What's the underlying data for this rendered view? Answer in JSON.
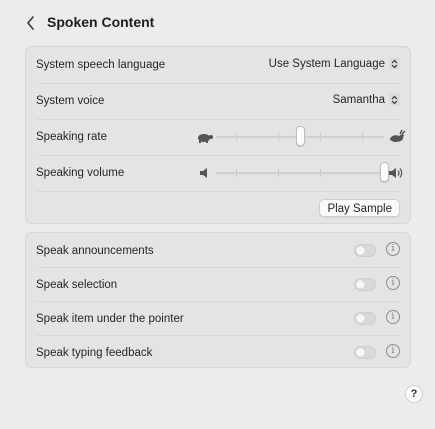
{
  "page": {
    "title": "Spoken Content"
  },
  "speech": {
    "language_label": "System speech language",
    "language_value": "Use System Language",
    "voice_label": "System voice",
    "voice_value": "Samantha",
    "rate_label": "Speaking rate",
    "rate_level": 0.5,
    "volume_label": "Speaking volume",
    "volume_level": 1.0,
    "play_sample": "Play Sample"
  },
  "options": [
    {
      "label": "Speak announcements",
      "enabled": false
    },
    {
      "label": "Speak selection",
      "enabled": false
    },
    {
      "label": "Speak item under the pointer",
      "enabled": false
    },
    {
      "label": "Speak typing feedback",
      "enabled": false
    }
  ],
  "help": {
    "label": "?"
  },
  "icons": {
    "back": "chevron-left-icon",
    "popup": "up-down-chevron-icon",
    "slow": "turtle-icon",
    "fast": "hare-icon",
    "vol_low": "speaker-low-icon",
    "vol_high": "speaker-high-icon",
    "info": "info-icon"
  }
}
